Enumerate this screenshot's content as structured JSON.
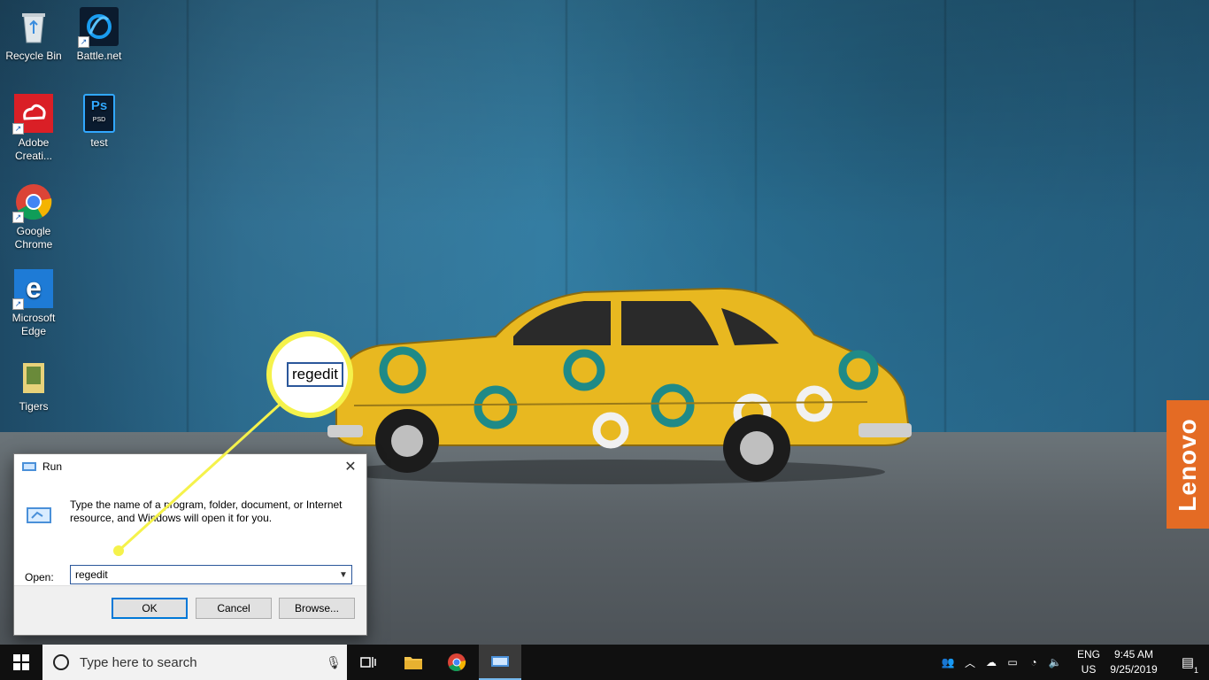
{
  "desktop": {
    "brand_label": "Lenovo",
    "icons": [
      {
        "label": "Recycle Bin"
      },
      {
        "label": "Battle.net"
      },
      {
        "label": "Adobe Creati..."
      },
      {
        "label": "test"
      },
      {
        "label": "Google Chrome"
      },
      {
        "label": "Microsoft Edge"
      },
      {
        "label": "Tigers"
      }
    ]
  },
  "run_dialog": {
    "title": "Run",
    "description": "Type the name of a program, folder, document, or Internet resource, and Windows will open it for you.",
    "open_label": "Open:",
    "open_value": "regedit",
    "ok_label": "OK",
    "cancel_label": "Cancel",
    "browse_label": "Browse..."
  },
  "callout": {
    "text": "regedit",
    "color": "#f5f24b"
  },
  "taskbar": {
    "search_placeholder": "Type here to search",
    "language_top": "ENG",
    "language_bottom": "US",
    "time": "9:45 AM",
    "date": "9/25/2019",
    "notification_count": "1",
    "pinned": [
      "task-view-icon",
      "file-explorer-icon",
      "chrome-icon",
      "run-icon"
    ]
  }
}
